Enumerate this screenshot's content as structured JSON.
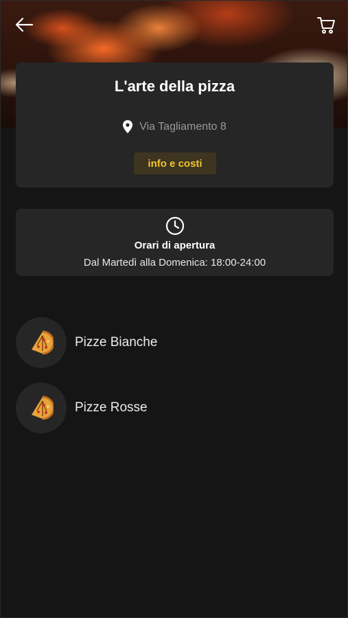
{
  "header": {
    "back_icon": "arrow-left-icon",
    "cart_icon": "shopping-cart-icon"
  },
  "restaurant": {
    "name": "L'arte della pizza",
    "address": "Via Tagliamento 8",
    "info_button": "info e costi"
  },
  "hours": {
    "title": "Orari di apertura",
    "text": "Dal Martedì alla Domenica: 18:00-24:00"
  },
  "categories": [
    {
      "label": "Pizze Bianche",
      "icon": "pizza-slice-icon"
    },
    {
      "label": "Pizze Rosse",
      "icon": "pizza-slice-icon"
    }
  ],
  "colors": {
    "background": "#151515",
    "card": "#262626",
    "accent": "#f4c430",
    "accent_bg": "#3d3520"
  }
}
